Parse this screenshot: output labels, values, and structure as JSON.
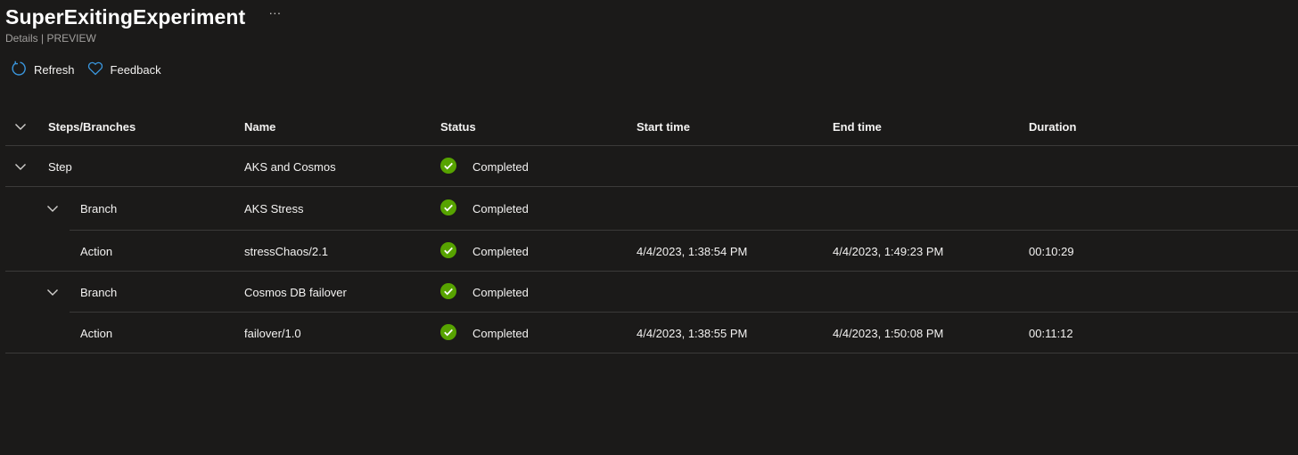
{
  "header": {
    "title": "SuperExitingExperiment",
    "more": "···",
    "subtitle": "Details | PREVIEW"
  },
  "toolbar": {
    "refresh_label": "Refresh",
    "feedback_label": "Feedback"
  },
  "colors": {
    "background": "#1b1a19",
    "accent": "#3a96dd",
    "success": "#57a300",
    "divider": "#3b3a39"
  },
  "table": {
    "columns": {
      "steps": "Steps/Branches",
      "name": "Name",
      "status": "Status",
      "start": "Start time",
      "end": "End time",
      "duration": "Duration"
    },
    "rows": [
      {
        "type": "Step",
        "name": "AKS and Cosmos",
        "status": "Completed",
        "start": "",
        "end": "",
        "duration": ""
      },
      {
        "type": "Branch",
        "name": "AKS Stress",
        "status": "Completed",
        "start": "",
        "end": "",
        "duration": ""
      },
      {
        "type": "Action",
        "name": "stressChaos/2.1",
        "status": "Completed",
        "start": "4/4/2023, 1:38:54 PM",
        "end": "4/4/2023, 1:49:23 PM",
        "duration": "00:10:29"
      },
      {
        "type": "Branch",
        "name": "Cosmos DB failover",
        "status": "Completed",
        "start": "",
        "end": "",
        "duration": ""
      },
      {
        "type": "Action",
        "name": "failover/1.0",
        "status": "Completed",
        "start": "4/4/2023, 1:38:55 PM",
        "end": "4/4/2023, 1:50:08 PM",
        "duration": "00:11:12"
      }
    ],
    "status_icon": "check-circle-icon"
  }
}
